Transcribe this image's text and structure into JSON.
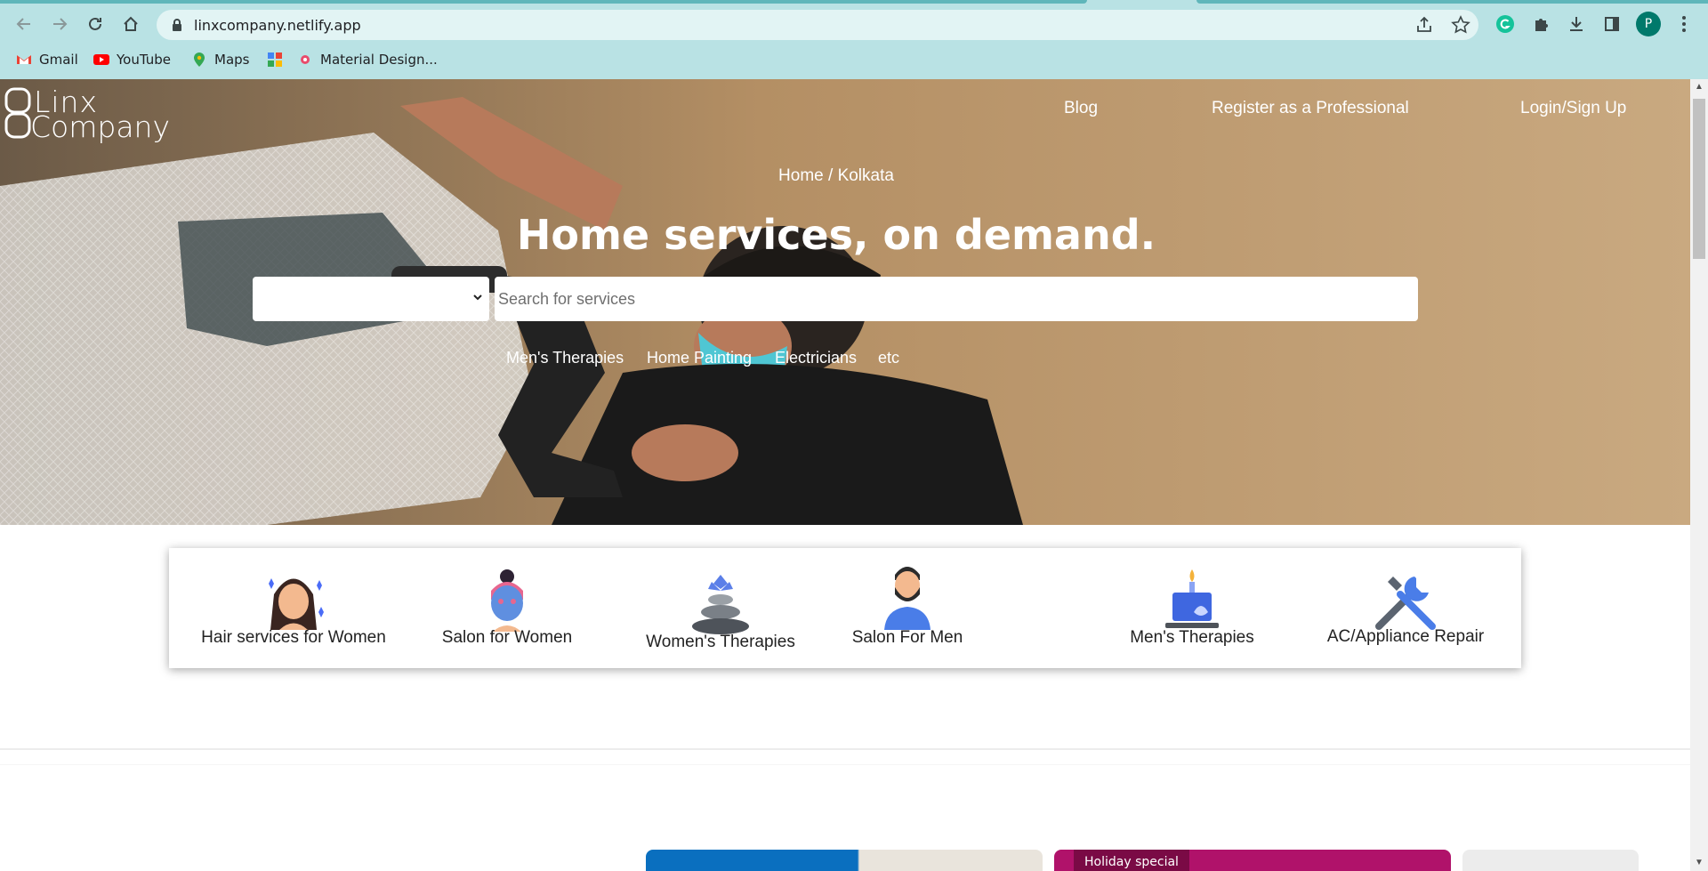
{
  "browser": {
    "url": "linxcompany.netlify.app",
    "profile_initial": "P",
    "bookmarks": [
      {
        "label": "Gmail"
      },
      {
        "label": "YouTube"
      },
      {
        "label": "Maps"
      },
      {
        "label": ""
      },
      {
        "label": "Material Design..."
      }
    ]
  },
  "site": {
    "logo_line1": "Linx",
    "logo_line2": "Company",
    "nav": {
      "blog": "Blog",
      "register": "Register as a Professional",
      "login": "Login/Sign Up"
    },
    "breadcrumb": "Home / Kolkata",
    "headline": "Home services, on demand.",
    "search_placeholder": "Search for services",
    "city_select_value": "",
    "quick_links": [
      "Men's Therapies",
      "Home Painting",
      "Electricians",
      "etc"
    ],
    "categories": [
      {
        "label": "Hair services for Women",
        "icon": "woman-hair-icon"
      },
      {
        "label": "Salon for Women",
        "icon": "face-mask-icon"
      },
      {
        "label": "Women's Therapies",
        "icon": "spa-stones-icon"
      },
      {
        "label": "Salon For Men",
        "icon": "bearded-man-icon"
      },
      {
        "label": "Men's Therapies",
        "icon": "candle-spa-icon"
      },
      {
        "label": "AC/Appliance Repair",
        "icon": "tools-icon"
      }
    ],
    "promo_badge": "Holiday special"
  },
  "colors": {
    "chrome_bg": "#b9e2e4",
    "promo_blue": "#0a6fbf",
    "promo_magenta": "#b0126a"
  }
}
